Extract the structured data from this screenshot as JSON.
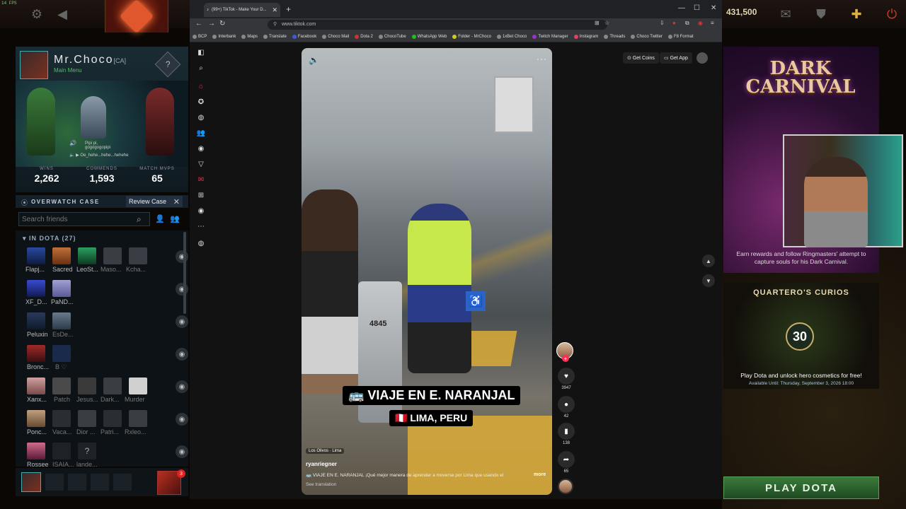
{
  "dota": {
    "fps_label": "14 FPS",
    "shards": "431,500",
    "icons": [
      "gear-icon",
      "back-arrow-icon",
      "mail-icon",
      "armory-icon",
      "plus-icon",
      "power-icon"
    ],
    "profile": {
      "name": "Mr.Choco",
      "tag": "[CA]",
      "status": "Main Menu",
      "music_line1": "Pipi pi,",
      "music_line2": "gogogogopipi",
      "music_track": "Oe_hehe...hehe...hehehe",
      "stats": [
        {
          "label": "WINS",
          "value": "2,262"
        },
        {
          "label": "COMMENDS",
          "value": "1,593"
        },
        {
          "label": "MATCH MVPS",
          "value": "65"
        }
      ]
    },
    "overwatch": {
      "title": "OVERWATCH CASE",
      "review_label": "Review Case",
      "close": "✕"
    },
    "friends": {
      "search_placeholder": "Search friends",
      "group_label": "IN DOTA (27)",
      "rows": [
        {
          "names": [
            "Flapj...",
            "Sacred",
            "LeoSt...",
            "Maso...",
            "Kcha..."
          ]
        },
        {
          "names": [
            "XF_D...",
            "PaND..."
          ]
        },
        {
          "names": [
            "Peluxin",
            "EsDe..."
          ]
        },
        {
          "names": [
            "Bronc...",
            "B ♡"
          ]
        },
        {
          "names": [
            "Xanx...",
            "Patch",
            "Jesus...",
            "Dark...",
            "Murder"
          ]
        },
        {
          "names": [
            "Ponc...",
            "Vaca...",
            "Dior ...",
            "Patri...",
            "Rxleo..."
          ]
        },
        {
          "names": [
            "Rossee",
            "ISAIA...",
            "lande..."
          ]
        }
      ]
    },
    "chat_badge": "3",
    "right": {
      "carnival_title": "DARK CARNIVAL",
      "carnival_desc": "Earn rewards and follow Ringmasters' attempt to capture souls for his Dark Carnival.",
      "curios_title": "QUARTERO'S CURIOS",
      "curios_count": "30",
      "curios_desc": "Play Dota and unlock hero cosmetics for free!",
      "curios_date": "Available Until: Thursday, September 3, 2026 18:00",
      "play_label": "PLAY DOTA"
    }
  },
  "browser": {
    "tab_title": "(99+) TikTok - Make Your D...",
    "url": "www.tiktok.com",
    "bookmarks": [
      "BCP",
      "Interbank",
      "Maps",
      "Translate",
      "Facebook",
      "Choco Mail",
      "Dota 2",
      "ChocoTube",
      "WhatsApp Web",
      "Folder - MrChoco",
      "1xBet Choco",
      "Twitch Manager",
      "Instagram",
      "Threads",
      "Choco Twitter",
      "F8 Format"
    ]
  },
  "tiktok": {
    "get_coins": "Get Coins",
    "get_app": "Get App",
    "gate_number": "4845",
    "caption1": "🚌 VIAJE EN E. NARANJAL",
    "caption2": "🇵🇪 LIMA, PERU",
    "location": "Los Olivos · Lima",
    "username": "ryanriegner",
    "description": "🚌 VIAJE EN E. NARANJAL ¡Qué mejor manera de aprender a moverse por Lima que usando el",
    "more": "more",
    "see_translation": "See translation",
    "likes": "3947",
    "comments": "42",
    "saves": "138",
    "shares": "65"
  }
}
